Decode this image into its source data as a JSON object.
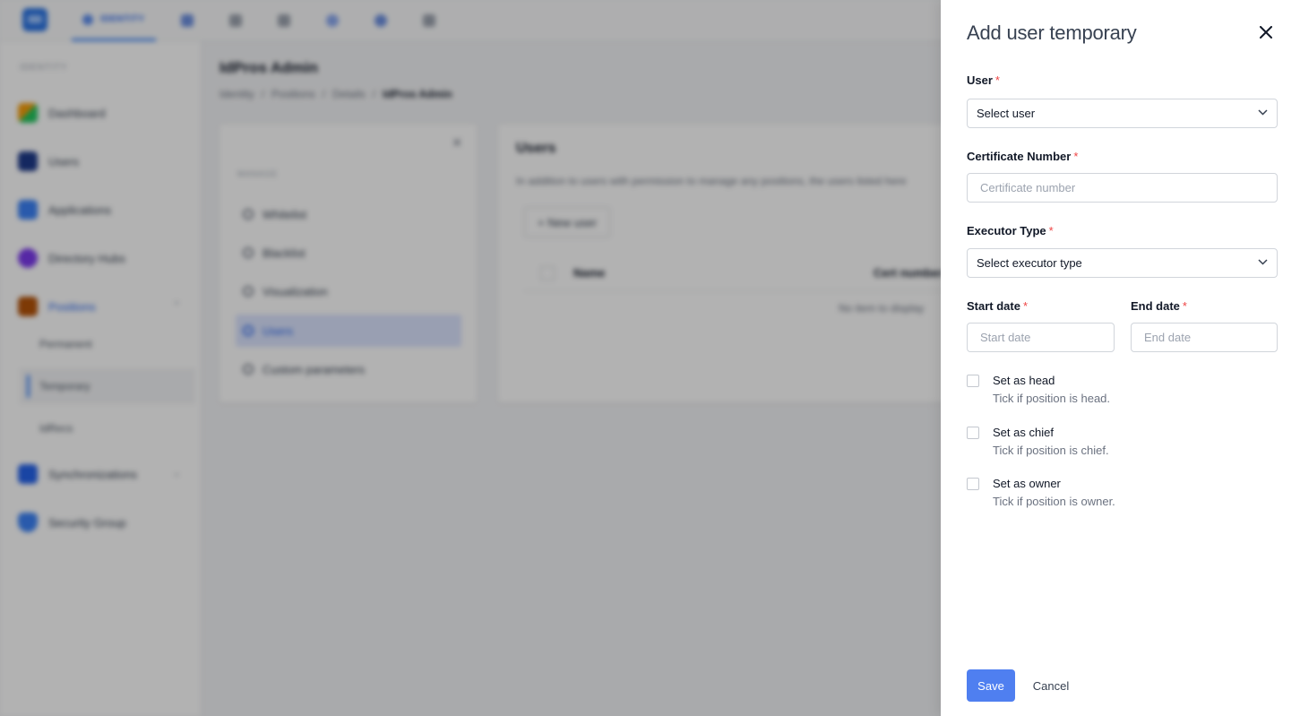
{
  "background": {
    "top_tab_label": "IDENTITY",
    "sidebar": {
      "heading": "IDENTITY",
      "items": [
        {
          "label": "Dashboard"
        },
        {
          "label": "Users"
        },
        {
          "label": "Applications"
        },
        {
          "label": "Directory Hubs"
        },
        {
          "label": "Positions"
        },
        {
          "label": "Synchronizations"
        },
        {
          "label": "Security Group"
        }
      ],
      "sub_items": [
        {
          "label": "Permanent"
        },
        {
          "label": "Temporary"
        },
        {
          "label": "IdRecs"
        }
      ]
    },
    "page_title": "IdPros Admin",
    "breadcrumb": [
      "Identity",
      "/",
      "Positions",
      "/",
      "Details",
      "/",
      "IdPros Admin"
    ],
    "left_menu": {
      "heading": "MANAGE",
      "items": [
        {
          "label": "Whitelist"
        },
        {
          "label": "Blacklist"
        },
        {
          "label": "Visualization"
        },
        {
          "label": "Users"
        },
        {
          "label": "Custom parameters"
        }
      ]
    },
    "main": {
      "title": "Users",
      "description": "In addition to users with permission to manage any positions, the users listed here",
      "new_user_label": "+ New user",
      "columns": [
        "Name",
        "Cert number"
      ],
      "empty_text": "No item to display"
    }
  },
  "drawer": {
    "title": "Add user temporary",
    "fields": {
      "user": {
        "label": "User",
        "placeholder": "Select user"
      },
      "certificate": {
        "label": "Certificate Number",
        "placeholder": "Certificate number"
      },
      "executor": {
        "label": "Executor Type",
        "placeholder": "Select executor type"
      },
      "start_date": {
        "label": "Start date",
        "placeholder": "Start date"
      },
      "end_date": {
        "label": "End date",
        "placeholder": "End date"
      }
    },
    "required_marker": "*",
    "checkboxes": [
      {
        "title": "Set as head",
        "description": "Tick if position is head."
      },
      {
        "title": "Set as chief",
        "description": "Tick if position is chief."
      },
      {
        "title": "Set as owner",
        "description": "Tick if position is owner."
      }
    ],
    "save_label": "Save",
    "cancel_label": "Cancel"
  },
  "colors": {
    "primary": "#4f7ff0",
    "required": "#ef4444",
    "overlay": "rgba(0,0,0,0.30)"
  }
}
